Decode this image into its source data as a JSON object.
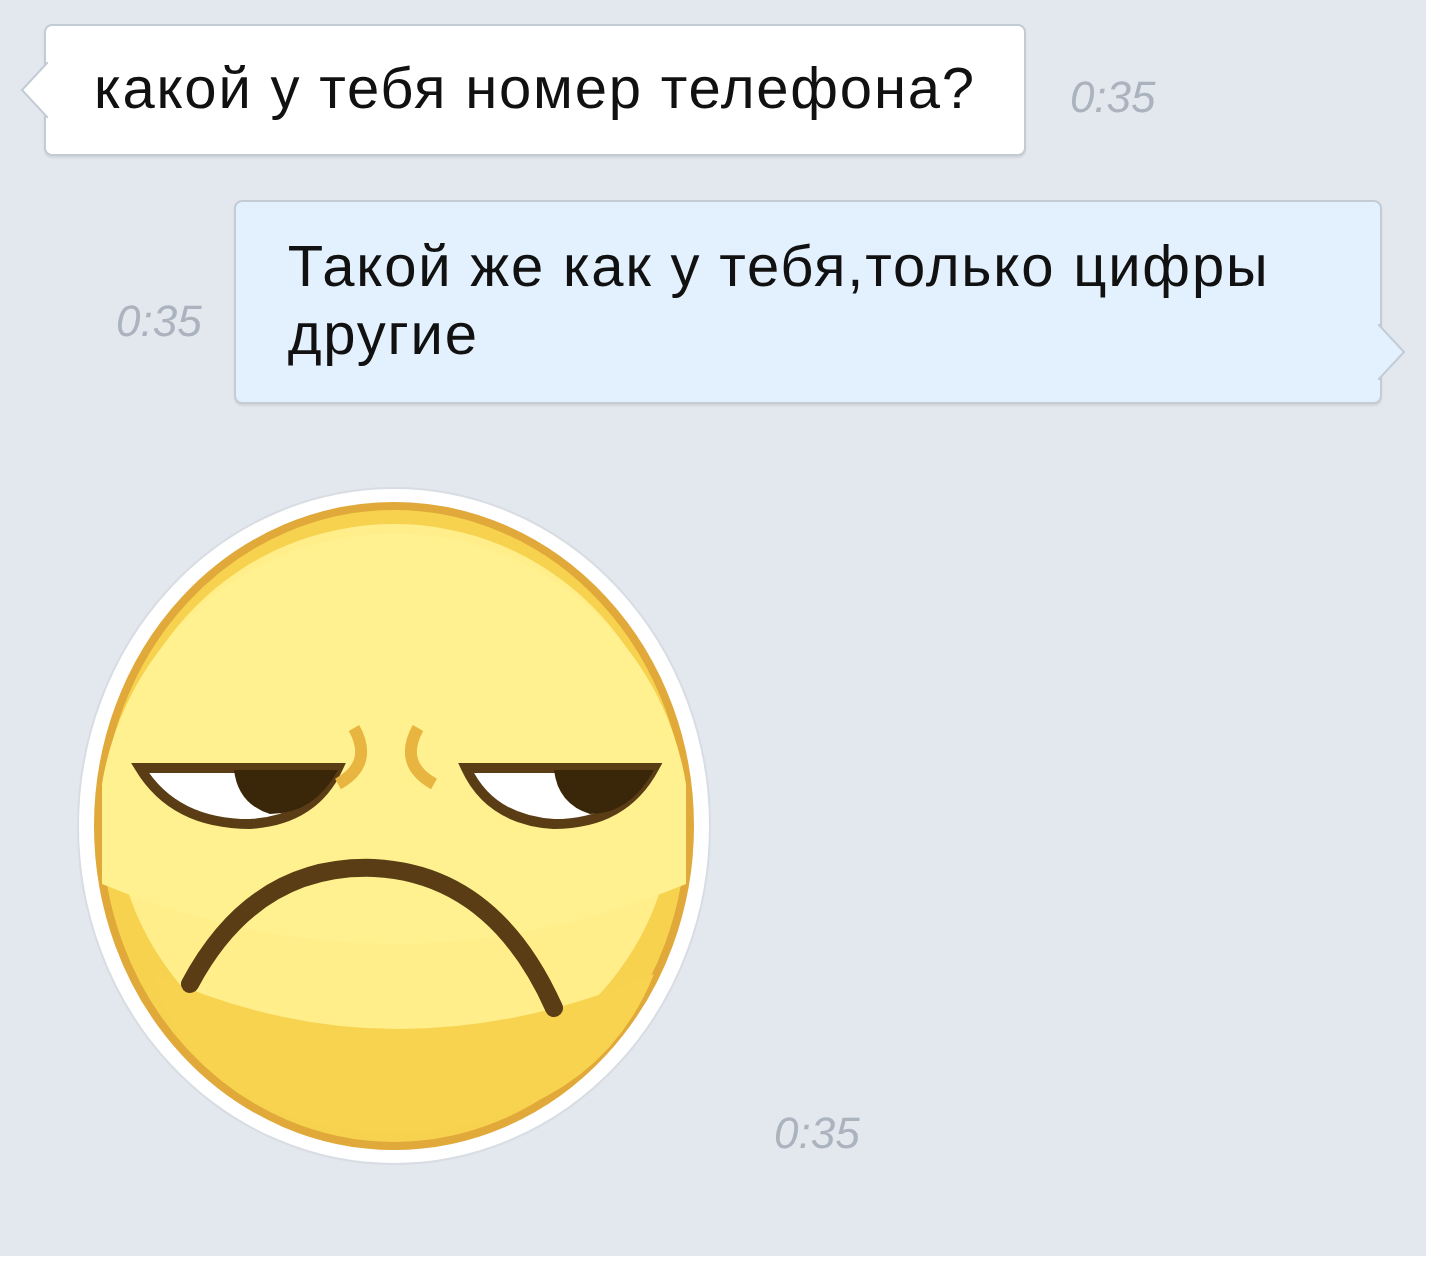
{
  "messages": [
    {
      "kind": "incoming",
      "text": "какой у тебя номер телефона?",
      "time": "0:35"
    },
    {
      "kind": "outgoing",
      "text": "Такой же как у тебя,только цифры другие",
      "time": "0:35"
    },
    {
      "kind": "sticker",
      "time": "0:35"
    }
  ]
}
